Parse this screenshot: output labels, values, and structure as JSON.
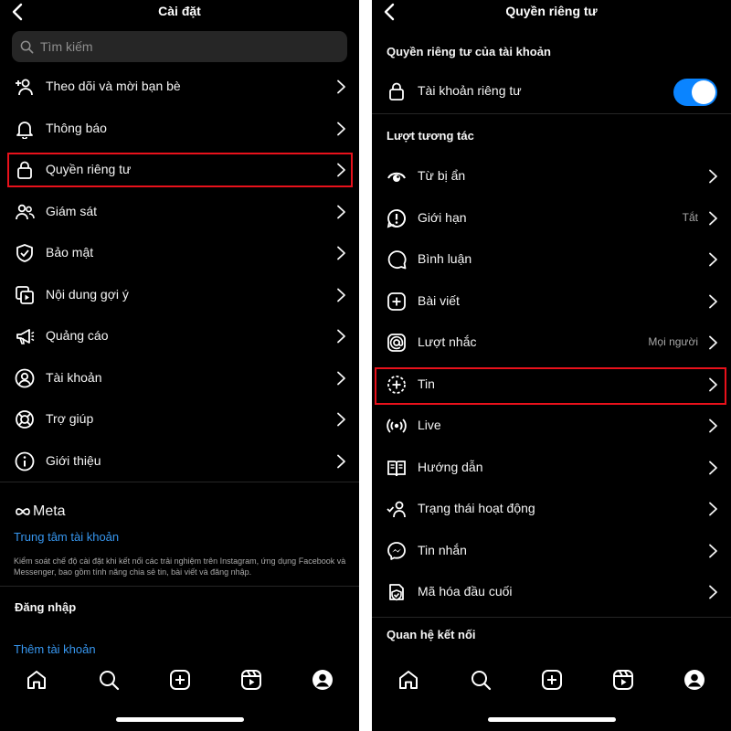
{
  "colors": {
    "background": "#000000",
    "accent_link": "#3797f0",
    "toggle_on": "#0a84ff",
    "highlight": "#e8111b"
  },
  "settings": {
    "title": "Cài đặt",
    "search_placeholder": "Tìm kiếm",
    "items": [
      {
        "label": "Theo dõi và mời bạn bè",
        "icon": "add-person-icon"
      },
      {
        "label": "Thông báo",
        "icon": "bell-icon"
      },
      {
        "label": "Quyền riêng tư",
        "icon": "lock-icon",
        "highlighted": true
      },
      {
        "label": "Giám sát",
        "icon": "people-icon"
      },
      {
        "label": "Bảo mật",
        "icon": "shield-icon"
      },
      {
        "label": "Nội dung gợi ý",
        "icon": "suggested-content-icon"
      },
      {
        "label": "Quảng cáo",
        "icon": "megaphone-icon"
      },
      {
        "label": "Tài khoản",
        "icon": "account-icon"
      },
      {
        "label": "Trợ giúp",
        "icon": "lifebuoy-icon"
      },
      {
        "label": "Giới thiệu",
        "icon": "info-icon"
      }
    ],
    "meta_brand": "Meta",
    "accounts_center": "Trung tâm tài khoản",
    "accounts_center_desc": "Kiểm soát chế độ cài đặt khi kết nối các trải nghiệm trên Instagram, ứng dụng Facebook và Messenger, bao gồm tính năng chia sẻ tin, bài viết và đăng nhập.",
    "login_header": "Đăng nhập",
    "add_account": "Thêm tài khoản"
  },
  "privacy": {
    "title": "Quyền riêng tư",
    "account_privacy_header": "Quyền riêng tư của tài khoản",
    "private_account_label": "Tài khoản riêng tư",
    "private_account_on": true,
    "interactions_header": "Lượt tương tác",
    "items": [
      {
        "label": "Từ bị ẩn",
        "icon": "hidden-words-icon",
        "value": ""
      },
      {
        "label": "Giới hạn",
        "icon": "limit-icon",
        "value": "Tắt"
      },
      {
        "label": "Bình luận",
        "icon": "comment-icon",
        "value": ""
      },
      {
        "label": "Bài viết",
        "icon": "post-icon",
        "value": ""
      },
      {
        "label": "Lượt nhắc",
        "icon": "mention-icon",
        "value": "Mọi người"
      },
      {
        "label": "Tin",
        "icon": "story-icon",
        "value": "",
        "highlighted": true
      },
      {
        "label": "Live",
        "icon": "live-icon",
        "value": ""
      },
      {
        "label": "Hướng dẫn",
        "icon": "guides-icon",
        "value": ""
      },
      {
        "label": "Trạng thái hoạt động",
        "icon": "activity-status-icon",
        "value": ""
      },
      {
        "label": "Tin nhắn",
        "icon": "messenger-icon",
        "value": ""
      },
      {
        "label": "Mã hóa đầu cuối",
        "icon": "encryption-icon",
        "value": ""
      }
    ],
    "connections_header": "Quan hệ kết nối"
  },
  "tabbar": [
    "home-icon",
    "search-icon",
    "create-icon",
    "reels-icon",
    "profile-icon"
  ]
}
